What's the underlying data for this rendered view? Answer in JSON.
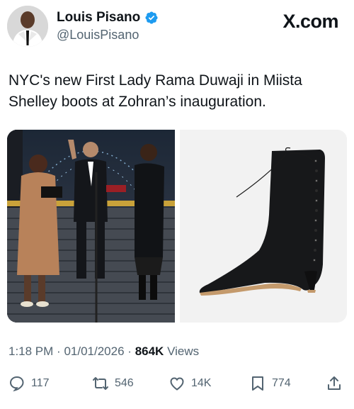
{
  "author": {
    "display_name": "Louis Pisano",
    "handle": "@LouisPisano",
    "verified_icon": "verified-badge-icon"
  },
  "brand": "X.com",
  "tweet": {
    "text": "NYC's new First Lady Rama Duwaji in Miista Shelley boots at Zohran’s inauguration."
  },
  "media": {
    "photo_icon": "inauguration-photo",
    "product_icon": "black-boot-photo"
  },
  "meta": {
    "time": "1:18 PM",
    "date": "01/01/2026",
    "views_count": "864K",
    "views_label": "Views",
    "separator": "·"
  },
  "actions": {
    "reply_count": "117",
    "repost_count": "546",
    "like_count": "14K",
    "bookmark_count": "774"
  },
  "colors": {
    "accent": "#1d9bf0",
    "text": "#0f1419",
    "secondary": "#536471"
  }
}
